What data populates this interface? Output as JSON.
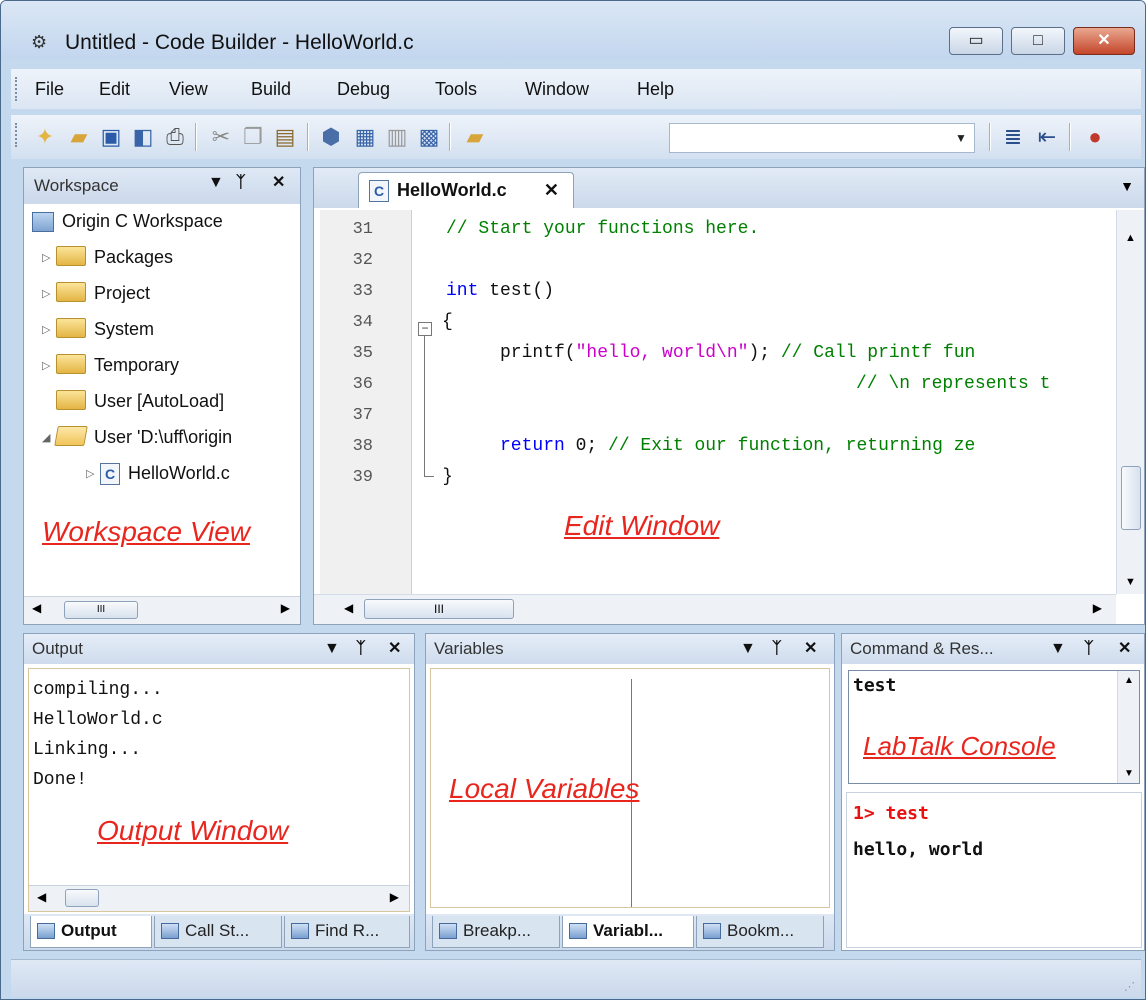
{
  "window": {
    "title": "Untitled - Code Builder - HelloWorld.c",
    "controls": {
      "minimize": "▭",
      "maximize": "□",
      "close": "✕"
    }
  },
  "menubar": {
    "items": [
      "File",
      "Edit",
      "View",
      "Build",
      "Debug",
      "Tools",
      "Window",
      "Help"
    ]
  },
  "toolbar": {
    "combo_value": "",
    "icons": [
      "new-file-icon",
      "open-folder-icon",
      "save-icon",
      "save-all-icon",
      "print-icon",
      "cut-icon",
      "copy-icon",
      "paste-icon",
      "compile-icon",
      "build-icon",
      "rebuild-icon",
      "build-all-icon",
      "open-workspace-icon",
      "indent-icon",
      "outdent-icon",
      "breakpoint-icon"
    ]
  },
  "workspace": {
    "header": "Workspace",
    "tree": [
      {
        "label": "Origin C Workspace",
        "level": 0,
        "type": "workspace"
      },
      {
        "label": "Packages",
        "level": 1,
        "type": "folder",
        "expander": "▷"
      },
      {
        "label": "Project",
        "level": 1,
        "type": "folder",
        "expander": "▷"
      },
      {
        "label": "System",
        "level": 1,
        "type": "folder",
        "expander": "▷"
      },
      {
        "label": "Temporary",
        "level": 1,
        "type": "folder",
        "expander": "▷"
      },
      {
        "label": "User  [AutoLoad]",
        "level": 1,
        "type": "folder",
        "expander": ""
      },
      {
        "label": "User 'D:\\uff\\origin",
        "level": 1,
        "type": "folder-open",
        "expander": "◢"
      },
      {
        "label": "HelloWorld.c",
        "level": 2,
        "type": "cfile",
        "expander": "▷"
      }
    ],
    "overlay_label": "Workspace View"
  },
  "editor": {
    "tab_label": "HelloWorld.c",
    "tab_close": "✕",
    "lines": [
      {
        "no": "31",
        "text": "// Start your functions here."
      },
      {
        "no": "32",
        "text": ""
      },
      {
        "no": "33",
        "text": "int test()"
      },
      {
        "no": "34",
        "text": "{"
      },
      {
        "no": "35",
        "text": "printf(\"hello, world\\n\"); // Call printf fun"
      },
      {
        "no": "36",
        "text": "// \\n represents t"
      },
      {
        "no": "37",
        "text": ""
      },
      {
        "no": "38",
        "text": "return 0; // Exit our function, returning ze"
      },
      {
        "no": "39",
        "text": "}"
      }
    ],
    "overlay_label": "Edit Window",
    "hscroll_thumb": "III"
  },
  "output": {
    "header": "Output",
    "lines": [
      "compiling...",
      "HelloWorld.c",
      "Linking...",
      "Done!"
    ],
    "overlay_label": "Output Window",
    "tabs": [
      "Output",
      "Call St...",
      "Find R..."
    ]
  },
  "variables": {
    "header": "Variables",
    "overlay_label": "Local Variables",
    "tabs": [
      "Breakp...",
      "Variabl...",
      "Bookm..."
    ]
  },
  "command": {
    "header": "Command & Res...",
    "history_text": "test",
    "overlay_label": "LabTalk Console",
    "console_prompt": "1> test",
    "console_result": "hello, world"
  },
  "colors": {
    "annotation_red": "#e8261e",
    "keyword_blue": "#0000ff",
    "comment_green": "#008000",
    "string_magenta": "#cc00cc",
    "prompt_red": "#e81010"
  }
}
